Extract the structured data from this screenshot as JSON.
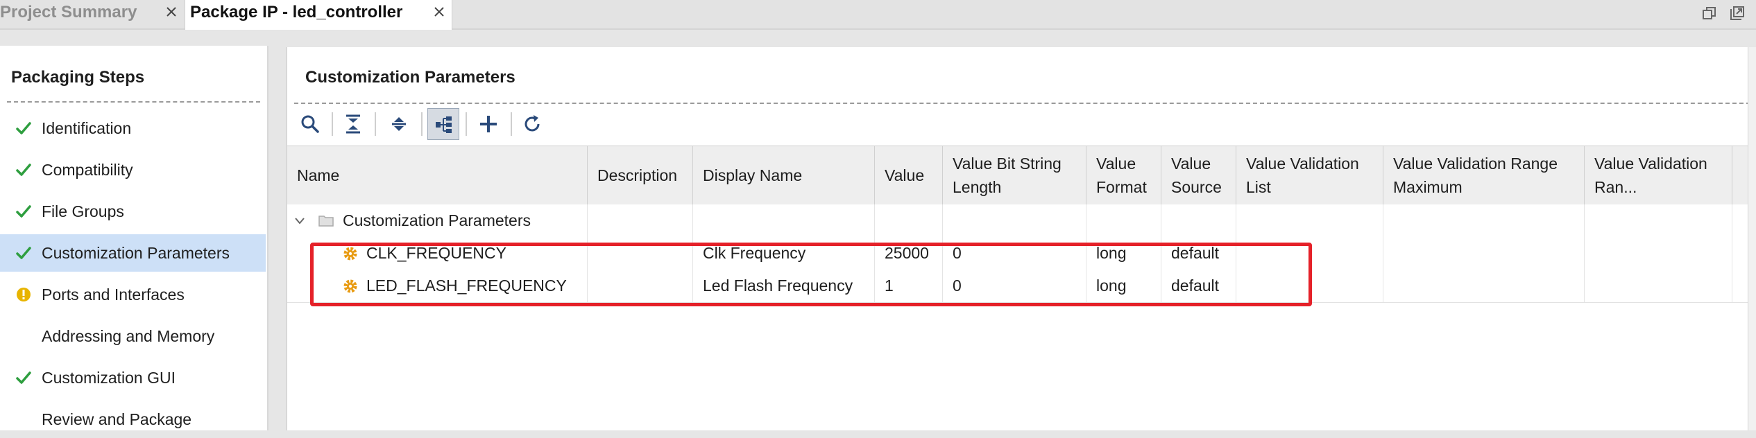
{
  "tabs": [
    {
      "label": "Project Summary",
      "active": false
    },
    {
      "label": "Package IP - led_controller",
      "active": true
    }
  ],
  "icons": {
    "tab_close": "close-icon",
    "window_restore": "restore-window-icon",
    "window_maximize": "maximize-window-icon",
    "step_done": "checkmark-icon",
    "step_warning": "warning-icon",
    "parameter": "gear-icon",
    "group": "folder-icon"
  },
  "colors": {
    "check": "#2e9e3f",
    "warning": "#e8b400",
    "selected_row": "#cde0f7",
    "highlight_box": "#e52129",
    "gear": "#e89b12"
  },
  "packaging_steps": {
    "title": "Packaging Steps",
    "items": [
      {
        "label": "Identification",
        "status": "done",
        "selected": false
      },
      {
        "label": "Compatibility",
        "status": "done",
        "selected": false
      },
      {
        "label": "File Groups",
        "status": "done",
        "selected": false
      },
      {
        "label": "Customization Parameters",
        "status": "done",
        "selected": true
      },
      {
        "label": "Ports and Interfaces",
        "status": "warning",
        "selected": false
      },
      {
        "label": "Addressing and Memory",
        "status": "none",
        "selected": false
      },
      {
        "label": "Customization GUI",
        "status": "done",
        "selected": false
      },
      {
        "label": "Review and Package",
        "status": "none",
        "selected": false
      }
    ]
  },
  "main": {
    "title": "Customization Parameters",
    "toolbar": [
      {
        "name": "search-button",
        "icon": "search-icon"
      },
      {
        "name": "collapse-all-button",
        "icon": "collapse-all-icon"
      },
      {
        "name": "expand-all-button",
        "icon": "expand-all-icon"
      },
      {
        "name": "group-by-hierarchy-button",
        "icon": "hierarchy-icon",
        "active": true
      },
      {
        "name": "add-parameter-button",
        "icon": "plus-icon"
      },
      {
        "name": "refresh-button",
        "icon": "refresh-icon"
      }
    ],
    "columns": [
      "Name",
      "Description",
      "Display Name",
      "Value",
      "Value Bit String Length",
      "Value Format",
      "Value Source",
      "Value Validation List",
      "Value Validation Range Maximum",
      "Value Validation Ran..."
    ],
    "group_row": {
      "label": "Customization Parameters",
      "expanded": true
    },
    "rows": [
      {
        "name": "CLK_FREQUENCY",
        "description": "",
        "display_name": "Clk Frequency",
        "value": "25000",
        "bit_length": "0",
        "format": "long",
        "source": "default",
        "validation_list": "",
        "range_max": "",
        "range_min": ""
      },
      {
        "name": "LED_FLASH_FREQUENCY",
        "description": "",
        "display_name": "Led Flash Frequency",
        "value": "1",
        "bit_length": "0",
        "format": "long",
        "source": "default",
        "validation_list": "",
        "range_max": "",
        "range_min": ""
      }
    ]
  }
}
